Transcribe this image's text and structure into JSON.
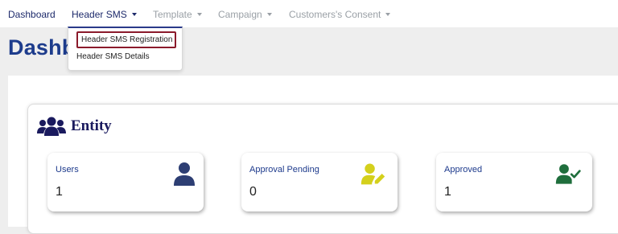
{
  "navbar": {
    "items": [
      {
        "label": "Dashboard"
      },
      {
        "label": "Header SMS"
      },
      {
        "label": "Template"
      },
      {
        "label": "Campaign"
      },
      {
        "label": "Customers's Consent"
      }
    ]
  },
  "dropdown": {
    "items": [
      {
        "label": "Header SMS Registration"
      },
      {
        "label": "Header SMS Details"
      }
    ]
  },
  "page": {
    "title": "Dashb"
  },
  "entity": {
    "title": "Entity",
    "icon": "users-group-icon"
  },
  "stats": [
    {
      "label": "Users",
      "value": "1",
      "icon": "user-icon",
      "color": "#2d3e73"
    },
    {
      "label": "Approval Pending",
      "value": "0",
      "icon": "user-edit-icon",
      "color": "#d4d01c"
    },
    {
      "label": "Approved",
      "value": "1",
      "icon": "user-check-icon",
      "color": "#1f6e3c"
    }
  ]
}
